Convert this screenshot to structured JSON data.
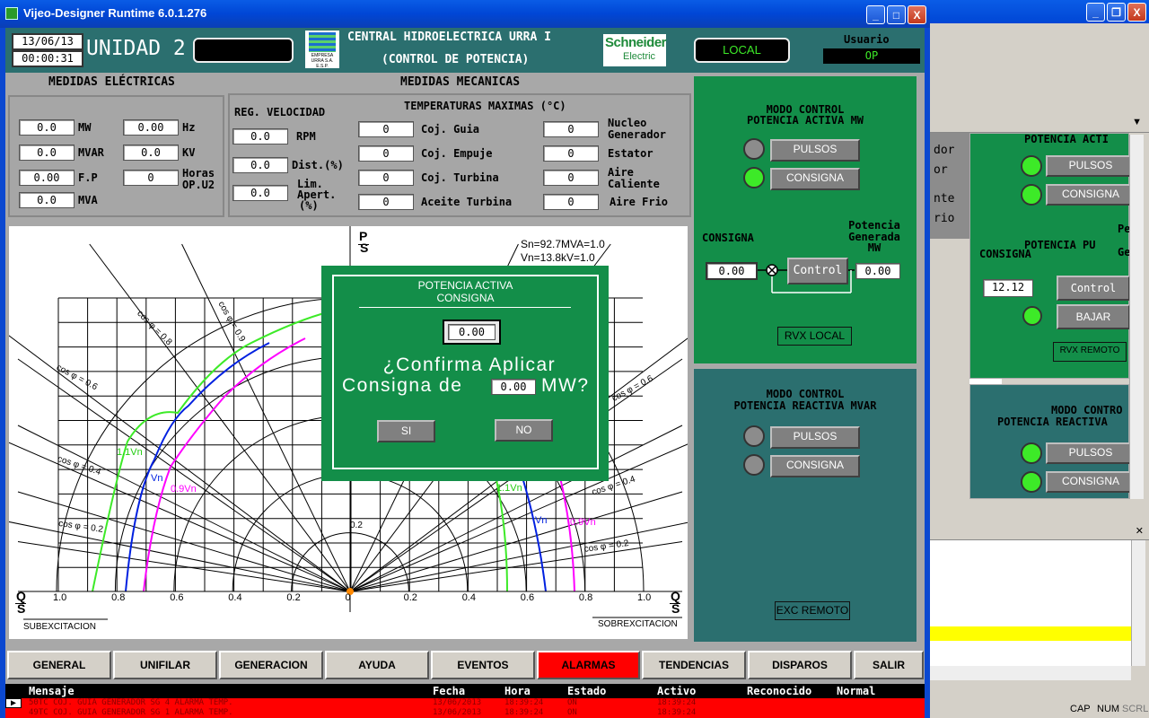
{
  "window": {
    "title": "Vijeo-Designer Runtime 6.0.1.276",
    "min": "_",
    "max": "□",
    "close": "X"
  },
  "header": {
    "date": "13/06/13",
    "time": "00:00:31",
    "unit": "UNIDAD 2",
    "company_title": "CENTRAL HIDROELECTRICA URRA I",
    "company_subtitle": "(CONTROL DE POTENCIA)",
    "logo_text": "EMPRESA URRA S.A. E.S.P.",
    "schneider_1": "Schneider",
    "schneider_2": "Electric",
    "mode": "LOCAL",
    "user_label": "Usuario",
    "user_value": "OP"
  },
  "electric": {
    "title": "MEDIDAS ELÉCTRICAS",
    "rows": [
      {
        "v1": "0.0",
        "u1": "MW",
        "v2": "0.00",
        "u2": "Hz"
      },
      {
        "v1": "0.0",
        "u1": "MVAR",
        "v2": "0.0",
        "u2": "KV"
      },
      {
        "v1": "0.00",
        "u1": "F.P",
        "v2": "0",
        "u2a": "Horas",
        "u2b": "OP.U2"
      },
      {
        "v1": "0.0",
        "u1": "MVA"
      }
    ]
  },
  "mechanical": {
    "title": "MEDIDAS MECANICAS",
    "reg_title": "REG. VELOCIDAD",
    "temp_title": "TEMPERATURAS MAXIMAS (°C)",
    "reg": [
      {
        "v": "0.0",
        "l": "RPM"
      },
      {
        "v": "0.0",
        "l": "Dist.(%)"
      },
      {
        "v": "0.0",
        "la": "Lim.",
        "lb": "Apert.",
        "lc": "(%)"
      }
    ],
    "temps_left": [
      {
        "v": "0",
        "l": "Coj. Guia"
      },
      {
        "v": "0",
        "l": "Coj. Empuje"
      },
      {
        "v": "0",
        "l": "Coj. Turbina"
      },
      {
        "v": "0",
        "l": "Aceite Turbina"
      }
    ],
    "temps_right": [
      {
        "v": "0",
        "la": "Nucleo",
        "lb": "Generador"
      },
      {
        "v": "0",
        "la": "Estator"
      },
      {
        "v": "0",
        "la": "Aire",
        "lb": "Caliente"
      },
      {
        "v": "0",
        "la": "Aire Frio"
      }
    ]
  },
  "active_panel": {
    "title1": "MODO CONTROL",
    "title2": "POTENCIA ACTIVA MW",
    "pulsos": "PULSOS",
    "consigna": "CONSIGNA",
    "consigna_label": "CONSIGNA",
    "gen_label1": "Potencia",
    "gen_label2": "Generada",
    "gen_label3": "MW",
    "consigna_value": "0.00",
    "control": "Control",
    "gen_value": "0.00",
    "rvx": "RVX LOCAL"
  },
  "reactive_panel": {
    "title1": "MODO CONTROL",
    "title2": "POTENCIA REACTIVA MVAR",
    "pulsos": "PULSOS",
    "consigna": "CONSIGNA",
    "exc": "EXC REMOTO"
  },
  "chart": {
    "p_s_top": "P",
    "p_s_bottom": "S",
    "sn": "Sn=92.7MVA=1.0",
    "vn": "Vn=13.8kV=1.0",
    "cos08": "cos φ = 0.8",
    "cos09": "cos φ = 0.9",
    "cos06l": "cos φ = 0.6",
    "cos04l": "cos φ = 0.4",
    "cos02l": "cos φ = 0.2",
    "cos06r": "cos φ = 0.6",
    "cos04r": "cos φ = 0.4",
    "cos02r": "cos φ = 0.2",
    "l11vn": "1.1Vn",
    "lvn": "Vn",
    "l09vn": "0.9Vn",
    "r11vn": "1.1Vn",
    "rvn": "Vn",
    "r09vn": "0.9Vn",
    "ticks": [
      "1.0",
      "0.8",
      "0.6",
      "0.4",
      "0.2",
      "0",
      "0.2",
      "0.4",
      "0.6",
      "0.8",
      "1.0"
    ],
    "q02": "0.2",
    "q_top": "Q",
    "q_bottom": "S",
    "sub": "SUBEXCITACION",
    "sobre": "SOBREXCITACION"
  },
  "dialog": {
    "title1": "POTENCIA ACTIVA",
    "title2": "CONSIGNA",
    "value": "0.00",
    "line1": "¿Confirma Aplicar",
    "line2a": "Consigna de",
    "line2_value": "0.00",
    "line2b": "MW?",
    "si": "SI",
    "no": "NO"
  },
  "nav": [
    "GENERAL",
    "UNIFILAR",
    "GENERACION",
    "AYUDA",
    "EVENTOS",
    "ALARMAS",
    "TENDENCIAS",
    "DISPAROS",
    "SALIR"
  ],
  "alarms": {
    "headers": [
      "Mensaje",
      "Fecha",
      "Hora",
      "Estado",
      "Activo",
      "Reconocido",
      "Normal"
    ],
    "rows": [
      {
        "msg": "50TC COJ. GUIA GENERADOR SG 4 ALARMA TEMP.",
        "fecha": "13/06/2013",
        "hora": "18:39:24",
        "estado": "ON",
        "activo": "18:39:24"
      },
      {
        "msg": "49TC COJ. GUIA GENERADOR SG 1 ALARMA TEMP.",
        "fecha": "13/06/2013",
        "hora": "18:39:24",
        "estado": "ON",
        "activo": "18:39:24"
      }
    ]
  },
  "bg_window": {
    "frag1": "dor",
    "frag2": "or",
    "frag3": "nte",
    "frag4": "rio",
    "pot_activa": "POTENCIA ACTI",
    "pulsos": "PULSOS",
    "consigna": "CONSIGNA",
    "consigna_lbl": "CONSIGNA",
    "pot_pu": "POTENCIA PU",
    "ge": "Ge",
    "pe": "Pe",
    "value": "12.12",
    "control": "Control",
    "bajar": "BAJAR",
    "rvx": "RVX REMOTO",
    "modo": "MODO CONTRO",
    "reactiva": "POTENCIA REACTIVA",
    "pulsos2": "PULSOS",
    "consigna2": "CONSIGNA",
    "status": [
      "CAP",
      "NUM",
      "SCRL"
    ]
  }
}
